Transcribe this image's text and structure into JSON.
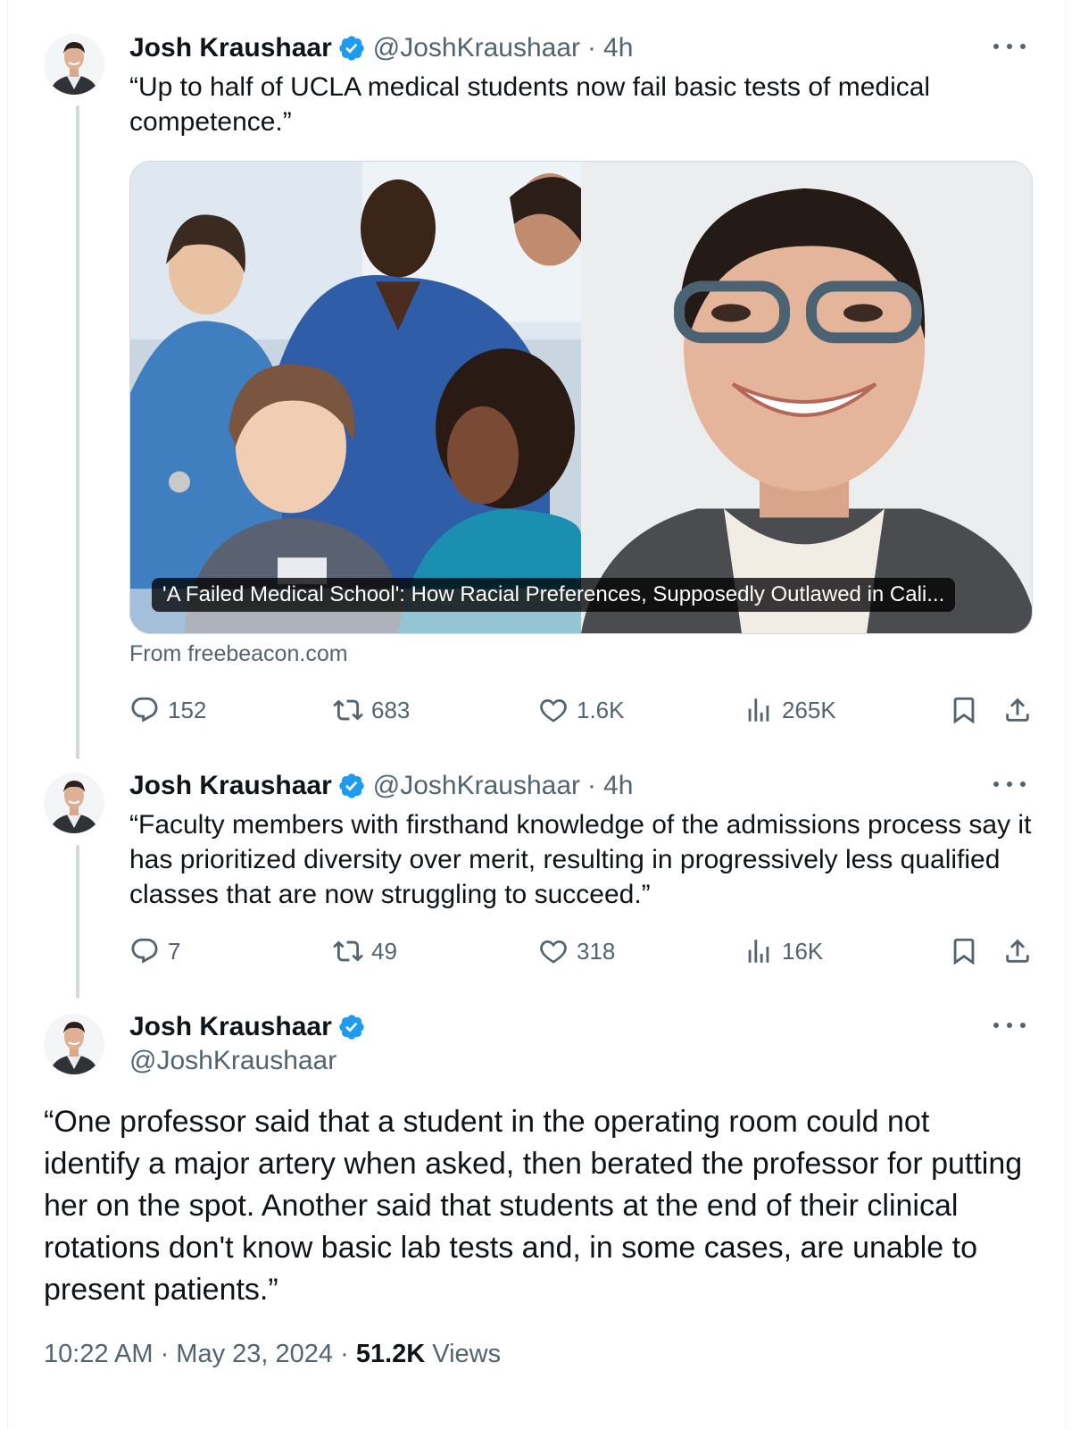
{
  "tweets": [
    {
      "author": "Josh Kraushaar",
      "handle": "@JoshKraushaar",
      "separator": "·",
      "time": "4h",
      "text": "“Up to half of UCLA medical students now fail basic tests of medical competence.”",
      "card": {
        "title": "'A Failed Medical School': How Racial Preferences, Supposedly Outlawed in Cali...",
        "source": "From freebeacon.com"
      },
      "stats": {
        "replies": "152",
        "reposts": "683",
        "likes": "1.6K",
        "views": "265K"
      }
    },
    {
      "author": "Josh Kraushaar",
      "handle": "@JoshKraushaar",
      "separator": "·",
      "time": "4h",
      "text": "“Faculty members with firsthand knowledge of the admissions process say it has prioritized diversity over merit, resulting in progressively less qualified classes that are now struggling to succeed.”",
      "stats": {
        "replies": "7",
        "reposts": "49",
        "likes": "318",
        "views": "16K"
      }
    }
  ],
  "main_tweet": {
    "author": "Josh Kraushaar",
    "handle": "@JoshKraushaar",
    "text": "“One professor said that a student in the operating room could not identify a major artery when asked, then berated the professor for putting her on the spot. Another said that students at the end of their clinical rotations don't know basic lab tests and, in some cases, are unable to present patients.”",
    "timestamp": "10:22 AM · May 23, 2024 · ",
    "views_count": "51.2K",
    "views_label": " Views"
  },
  "icons": {
    "verified": "verified-badge-icon",
    "more": "more-options-icon",
    "reply": "reply-bubble-icon",
    "repost": "repost-arrows-icon",
    "like": "heart-icon",
    "views": "bar-chart-icon",
    "bookmark": "bookmark-icon",
    "share": "share-upload-icon"
  },
  "colors": {
    "text": "#0f1419",
    "secondary": "#536471",
    "verified": "#1d9bf0",
    "thread_line": "#cfd9de"
  }
}
